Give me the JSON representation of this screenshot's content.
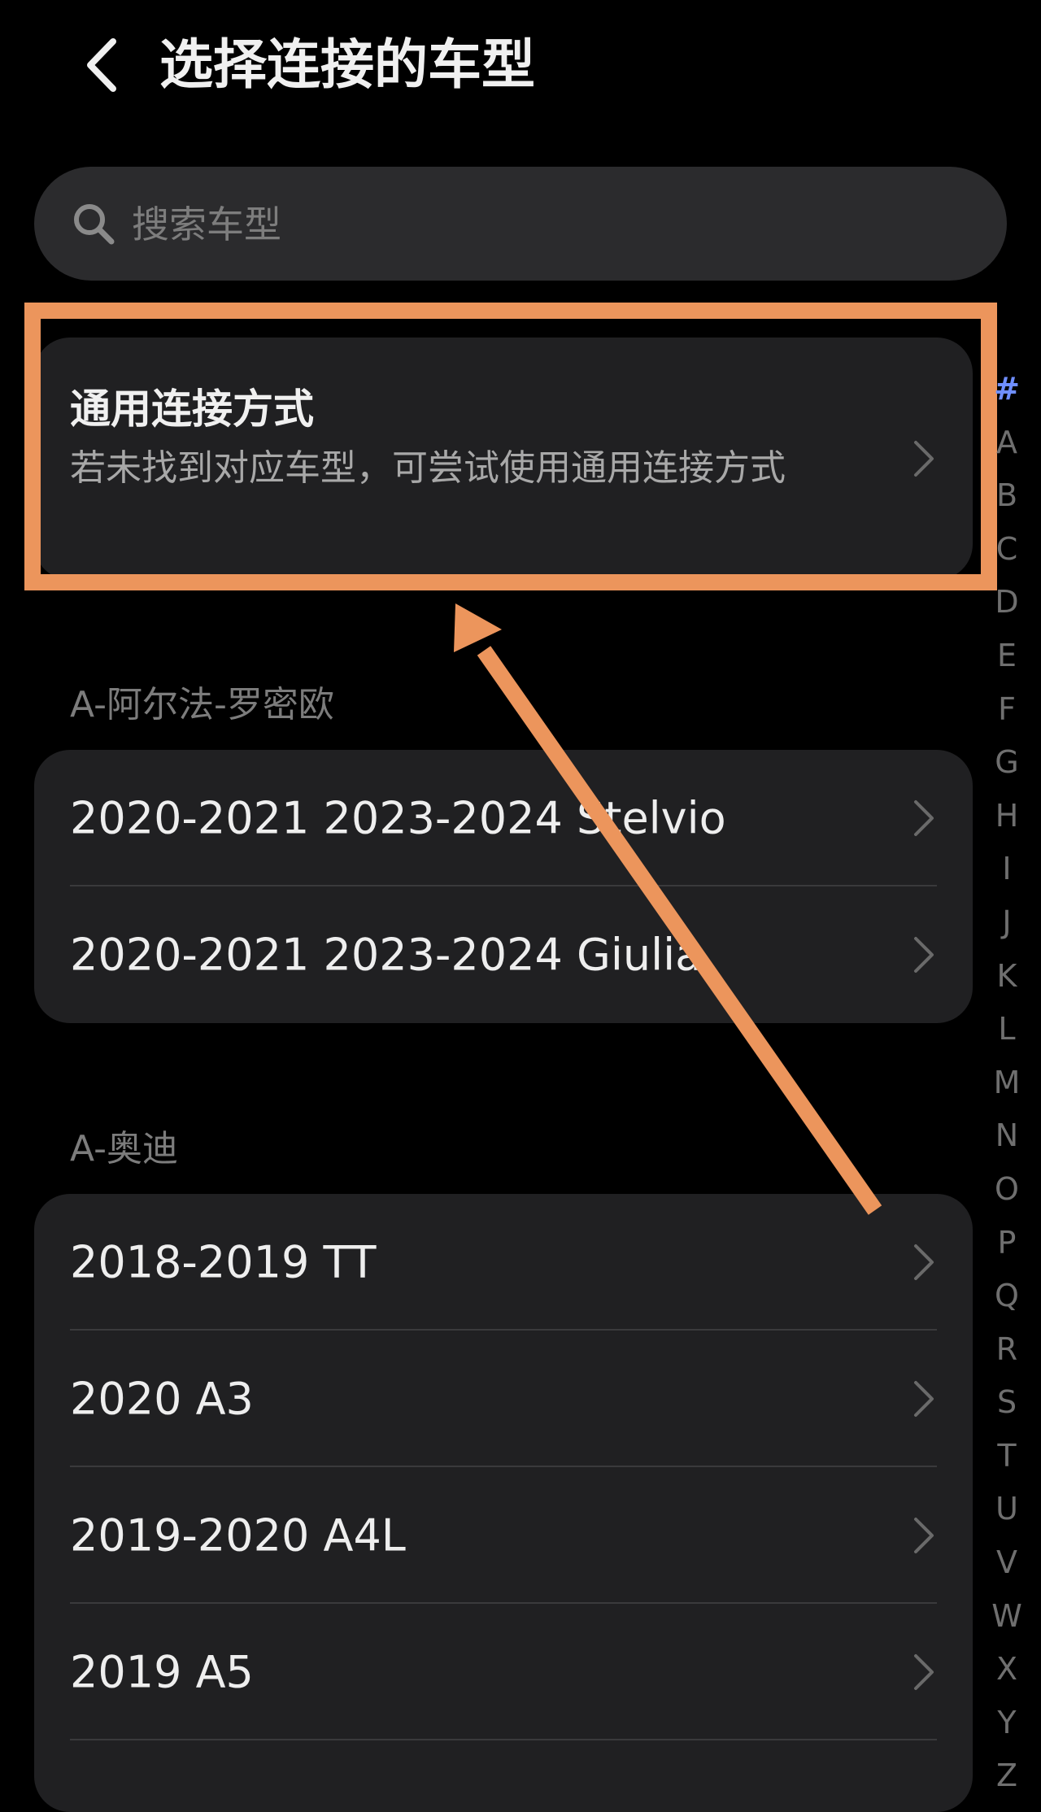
{
  "header": {
    "title": "选择连接的车型"
  },
  "search": {
    "placeholder": "搜索车型"
  },
  "generic_option": {
    "title": "通用连接方式",
    "description": "若未找到对应车型，可尝试使用通用连接方式"
  },
  "sections": [
    {
      "header": "A-阿尔法-罗密欧",
      "items": [
        {
          "label": "2020-2021 2023-2024 Stelvio"
        },
        {
          "label": "2020-2021 2023-2024 Giulia"
        }
      ]
    },
    {
      "header": "A-奥迪",
      "items": [
        {
          "label": "2018-2019 TT"
        },
        {
          "label": "2020 A3"
        },
        {
          "label": "2019-2020 A4L"
        },
        {
          "label": "2019 A5"
        }
      ]
    }
  ],
  "alpha_index": [
    "#",
    "A",
    "B",
    "C",
    "D",
    "E",
    "F",
    "G",
    "H",
    "I",
    "J",
    "K",
    "L",
    "M",
    "N",
    "O",
    "P",
    "Q",
    "R",
    "S",
    "T",
    "U",
    "V",
    "W",
    "X",
    "Y",
    "Z"
  ],
  "colors": {
    "background": "#000000",
    "card": "#202022",
    "search_bg": "#2b2b2d",
    "annotation": "#ec955c",
    "index_active": "#6f8eff",
    "index_inactive": "#6f6f6f"
  },
  "icons": {
    "back": "chevron-left-icon",
    "search": "search-icon",
    "row_chevron": "chevron-right-icon"
  }
}
